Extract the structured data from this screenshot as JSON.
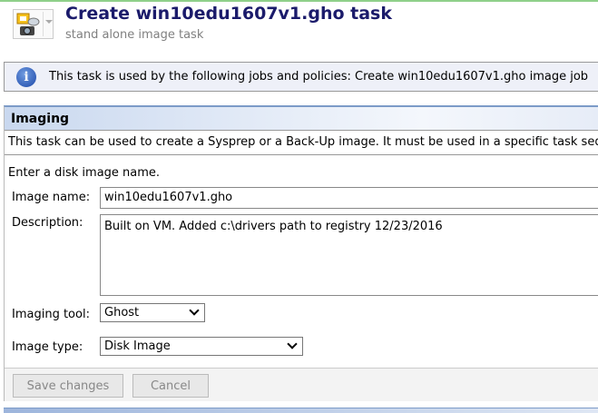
{
  "header": {
    "title": "Create win10edu1607v1.gho task",
    "subtitle": "stand alone image task"
  },
  "info": {
    "message": "This task is used by the following jobs and policies: Create win10edu1607v1.gho image job"
  },
  "panel": {
    "title": "Imaging",
    "description": "This task can be used to create a Sysprep or a Back-Up image. It must be used in a specific task sequence",
    "prompt": "Enter a disk image name.",
    "image_name_label": "Image name:",
    "image_name_value": "win10edu1607v1.gho",
    "description_label": "Description:",
    "description_value": "Built on VM.  Added c:\\drivers path to registry 12/23/2016",
    "imaging_tool_label": "Imaging tool:",
    "imaging_tool_value": "Ghost",
    "image_type_label": "Image type:",
    "image_type_value": "Disk Image",
    "save_label": "Save changes",
    "cancel_label": "Cancel"
  }
}
